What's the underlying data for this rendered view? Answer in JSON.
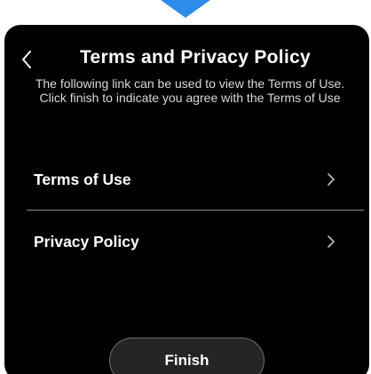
{
  "header": {
    "title": "Terms and Privacy Policy",
    "description": "The following link can be used to view the Terms of Use. Click finish to indicate you agree with the Terms of Use",
    "back_icon": "chevron-left-icon"
  },
  "menu": {
    "items": [
      {
        "label": "Terms of Use",
        "icon": "chevron-right-icon"
      },
      {
        "label": "Privacy Policy",
        "icon": "chevron-right-icon"
      }
    ]
  },
  "footer": {
    "finish_label": "Finish"
  },
  "colors": {
    "pointer": "#2D8CEB",
    "panel_background": "#000000",
    "text": "#FFFFFF",
    "divider": "#8A8A8A",
    "button_background": "#242424",
    "button_border": "#6F6F6F"
  }
}
